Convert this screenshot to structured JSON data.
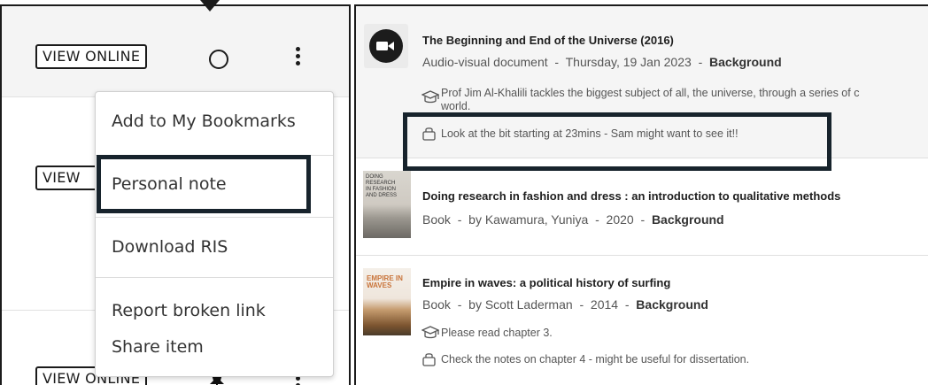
{
  "left": {
    "view_online_label": "VIEW ONLINE",
    "row2_button_label": "VIEW",
    "row3_button_label": "VIEW ONLINE"
  },
  "menu": {
    "items": [
      {
        "label": "Add to My Bookmarks"
      },
      {
        "label": "Personal note"
      },
      {
        "label": "Download RIS"
      },
      {
        "label": "Report broken link"
      },
      {
        "label": "Share item"
      }
    ]
  },
  "results": [
    {
      "title": "The Beginning and End of the Universe (2016)",
      "type": "Audio-visual document",
      "date": "Thursday, 19 Jan 2023",
      "category": "Background",
      "description_line1": "Prof Jim Al-Khalili tackles the biggest subject of all, the universe, through a series of c",
      "description_line2": "world.",
      "personal_note": "Look at the bit starting at 23mins - Sam might want to see it!!"
    },
    {
      "title": "Doing research in fashion and dress : an introduction to qualitative methods",
      "type": "Book",
      "author": "by Kawamura, Yuniya",
      "year": "2020",
      "category": "Background"
    },
    {
      "title": "Empire in waves: a political history of surfing",
      "type": "Book",
      "author": "by Scott Laderman",
      "year": "2014",
      "category": "Background",
      "reading_note": "Please read chapter 3.",
      "personal_note": "Check the notes on chapter 4 - might be useful for dissertation."
    }
  ],
  "covers": {
    "cover1_text": "DOING RESEARCH IN FASHION AND DRESS",
    "cover2_text": "EMPIRE IN WAVES"
  },
  "separator": "-",
  "colors": {
    "highlight_border": "#17232c",
    "panel_border": "#1b1b1b",
    "row_bg": "#f4f4f4"
  },
  "icons": {
    "video": "video-camera-icon",
    "graduation": "graduation-cap-icon",
    "lock": "lock-icon",
    "circle": "circle-outline-icon",
    "kebab": "kebab-menu-icon",
    "pin": "pin-icon"
  }
}
